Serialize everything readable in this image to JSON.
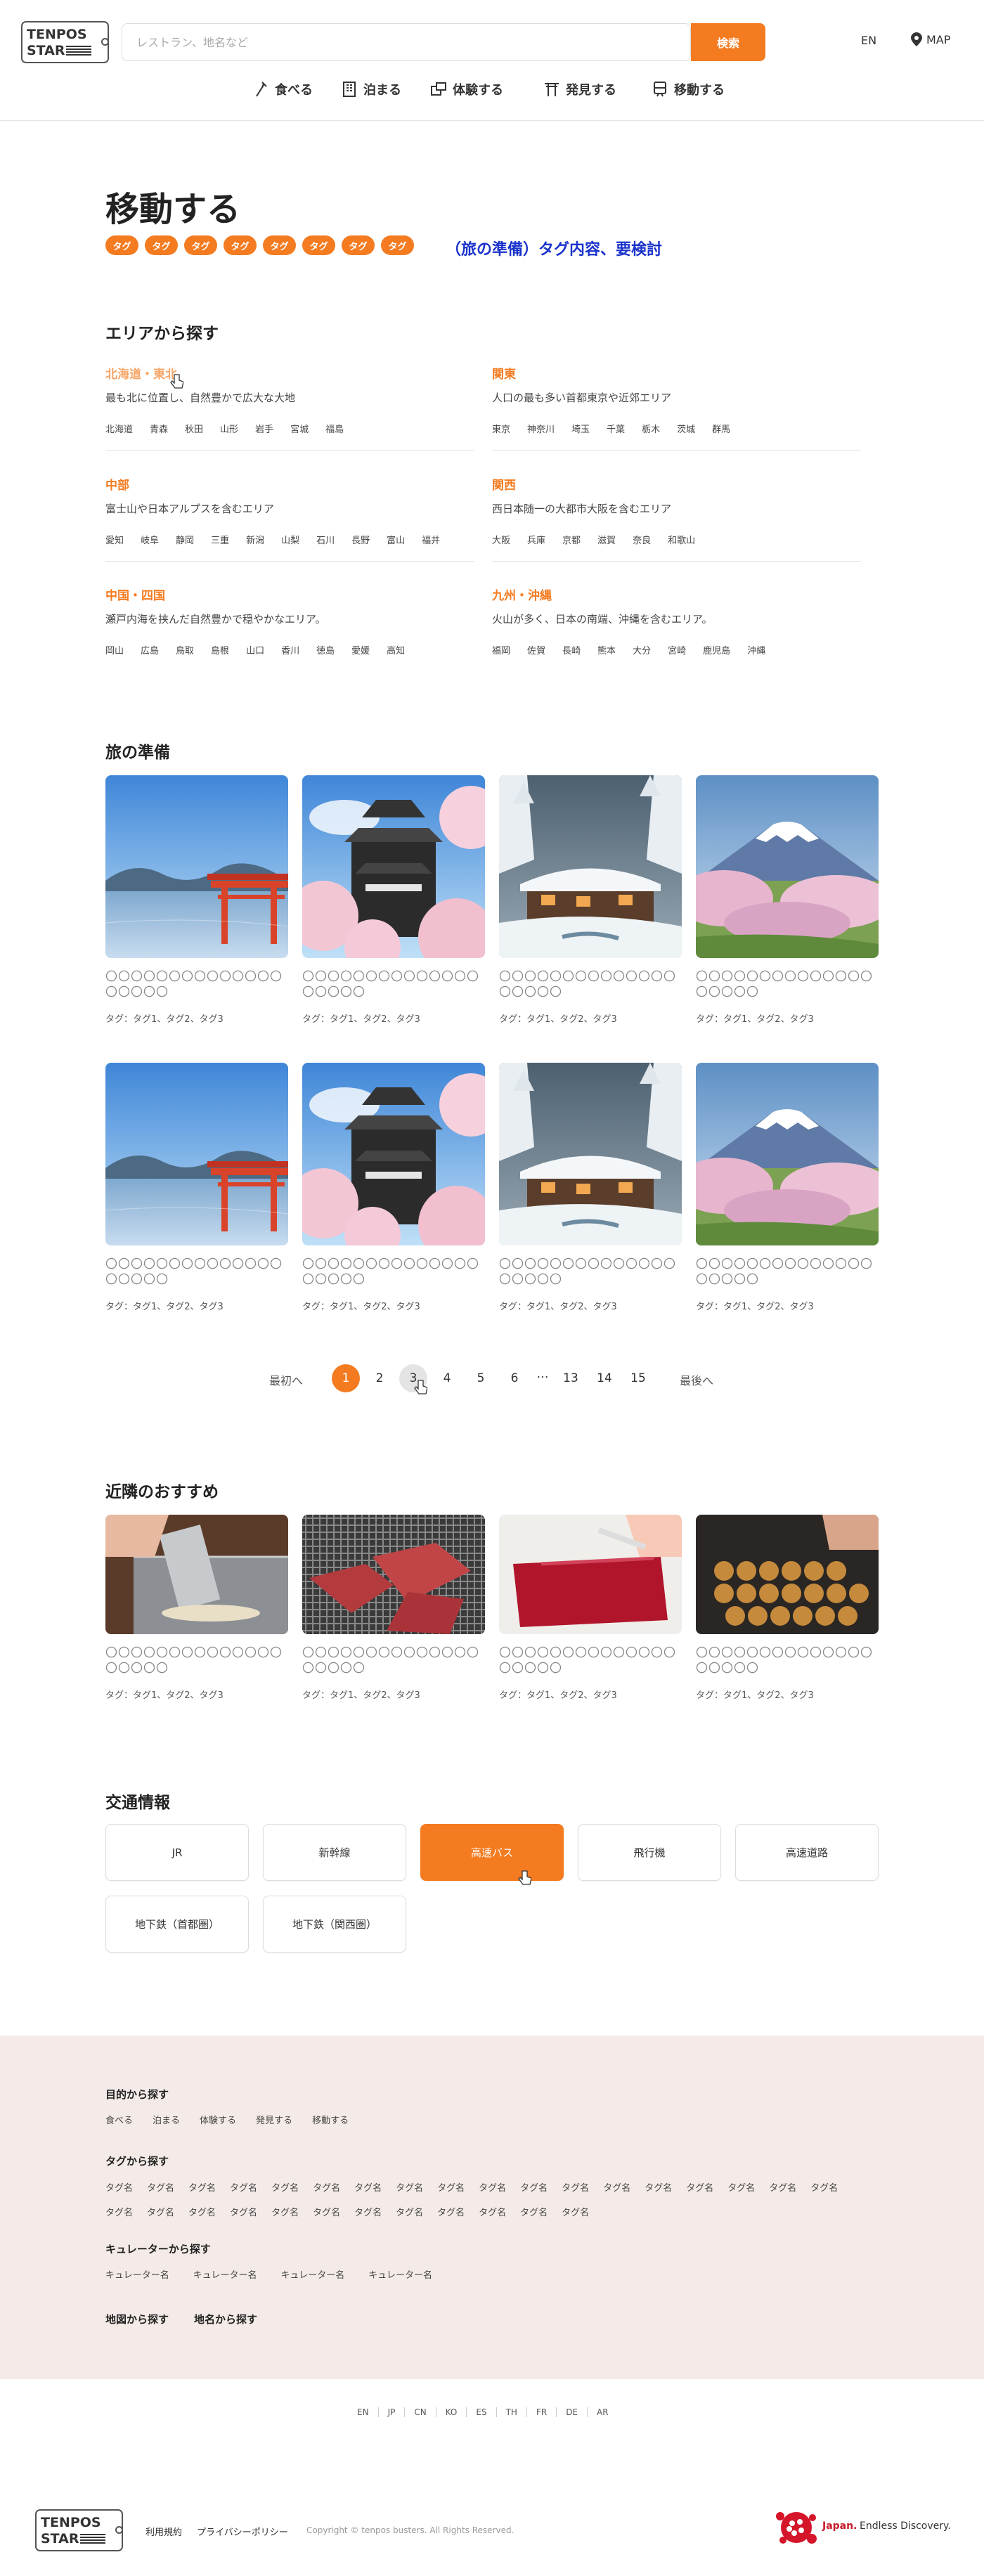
{
  "header": {
    "logo_line1": "TENPOS",
    "logo_line2": "STAR",
    "search_placeholder": "レストラン、地名など",
    "search_button": "検索",
    "lang": "EN",
    "map": "MAP",
    "nav": [
      "食べる",
      "泊まる",
      "体験する",
      "発見する",
      "移動する"
    ]
  },
  "page": {
    "title": "移動する",
    "tags": [
      "タグ",
      "タグ",
      "タグ",
      "タグ",
      "タグ",
      "タグ",
      "タグ",
      "タグ"
    ],
    "tag_note": "（旅の準備）タグ内容、要検討"
  },
  "areas": {
    "title": "エリアから探す",
    "items": [
      {
        "name": "北海道・東北",
        "desc": "最も北に位置し、自然豊かで広大な大地",
        "prefs": [
          "北海道",
          "青森",
          "秋田",
          "山形",
          "岩手",
          "宮城",
          "福島"
        ]
      },
      {
        "name": "関東",
        "desc": "人口の最も多い首都東京や近郊エリア",
        "prefs": [
          "東京",
          "神奈川",
          "埼玉",
          "千葉",
          "栃木",
          "茨城",
          "群馬"
        ]
      },
      {
        "name": "中部",
        "desc": "富士山や日本アルプスを含むエリア",
        "prefs": [
          "愛知",
          "岐阜",
          "静岡",
          "三重",
          "新潟",
          "山梨",
          "石川",
          "長野",
          "富山",
          "福井"
        ]
      },
      {
        "name": "関西",
        "desc": "西日本随一の大都市大阪を含むエリア",
        "prefs": [
          "大阪",
          "兵庫",
          "京都",
          "滋賀",
          "奈良",
          "和歌山"
        ]
      },
      {
        "name": "中国・四国",
        "desc": "瀬戸内海を挟んだ自然豊かで穏やかなエリア。",
        "prefs": [
          "岡山",
          "広島",
          "鳥取",
          "島根",
          "山口",
          "香川",
          "徳島",
          "愛媛",
          "高知"
        ]
      },
      {
        "name": "九州・沖縄",
        "desc": "火山が多く、日本の南端、沖縄を含むエリア。",
        "prefs": [
          "福岡",
          "佐賀",
          "長崎",
          "熊本",
          "大分",
          "宮崎",
          "鹿児島",
          "沖縄"
        ]
      }
    ]
  },
  "prep": {
    "title": "旅の準備",
    "card_title": "〇〇〇〇〇〇〇〇〇〇〇〇〇〇〇〇〇〇〇",
    "card_tags": "タグ：タグ1、タグ2、タグ3"
  },
  "pagination": {
    "first": "最初へ",
    "last": "最後へ",
    "pages": [
      "1",
      "2",
      "3",
      "4",
      "5",
      "6",
      "…",
      "13",
      "14",
      "15"
    ],
    "current": "1"
  },
  "nearby": {
    "title": "近隣のおすすめ",
    "card_title": "〇〇〇〇〇〇〇〇〇〇〇〇〇〇〇〇〇〇〇",
    "card_tags": "タグ：タグ1、タグ2、タグ3"
  },
  "transport": {
    "title": "交通情報",
    "buttons": [
      "JR",
      "新幹線",
      "高速バス",
      "飛行機",
      "高速道路",
      "地下鉄（首都圏）",
      "地下鉄（関西圏）"
    ],
    "active": "高速バス"
  },
  "footer": {
    "purpose_title": "目的から探す",
    "purpose_links": [
      "食べる",
      "泊まる",
      "体験する",
      "発見する",
      "移動する"
    ],
    "tags_title": "タグから探す",
    "tag_label": "タグ名",
    "curator_title": "キュレーターから探す",
    "curators": [
      "キュレーター名",
      "キュレーター名",
      "キュレーター名",
      "キュレーター名"
    ],
    "map_search": "地図から探す",
    "place_search": "地名から探す",
    "languages": [
      "EN",
      "JP",
      "CN",
      "KO",
      "ES",
      "TH",
      "FR",
      "DE",
      "AR"
    ],
    "terms": "利用規約",
    "privacy": "プライバシーポリシー",
    "copyright": "Copyright © tenpos busters. All Rights Reserved.",
    "jnto_brand": "Japan.",
    "jnto_tagline": "Endless Discovery."
  },
  "colors": {
    "accent": "#f47b20",
    "note": "#1a33cc",
    "footer_bg": "#f4ebe8"
  }
}
